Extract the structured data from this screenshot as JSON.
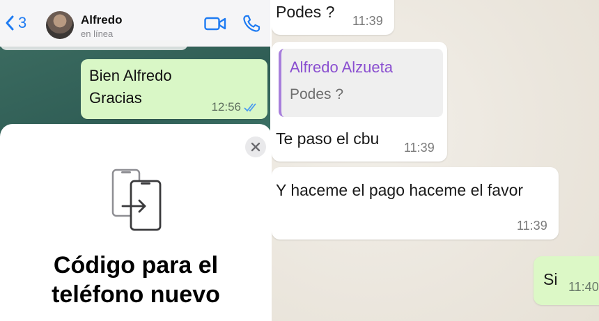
{
  "left": {
    "header": {
      "back_count": "3",
      "contact_name": "Alfredo",
      "contact_status": "en línea",
      "icons": [
        "chevron-left-icon",
        "video-call-icon",
        "phone-icon"
      ],
      "accent_color": "#1e7bf2"
    },
    "outgoing_message": {
      "line1": "Bien Alfredo",
      "line2": "Gracias",
      "time": "12:56"
    },
    "sheet": {
      "title_line1": "Código para el",
      "title_line2": "teléfono nuevo"
    }
  },
  "right": {
    "messages": [
      {
        "text": "Podes ?",
        "time": "11:39"
      },
      {
        "quoted_name": "Alfredo Alzueta",
        "quoted_text": "Podes ?",
        "text": "Te paso el cbu",
        "time": "11:39"
      },
      {
        "text": "Y haceme el pago haceme el favor",
        "time": "11:39"
      },
      {
        "text": "Si",
        "time": "11:40"
      }
    ]
  }
}
